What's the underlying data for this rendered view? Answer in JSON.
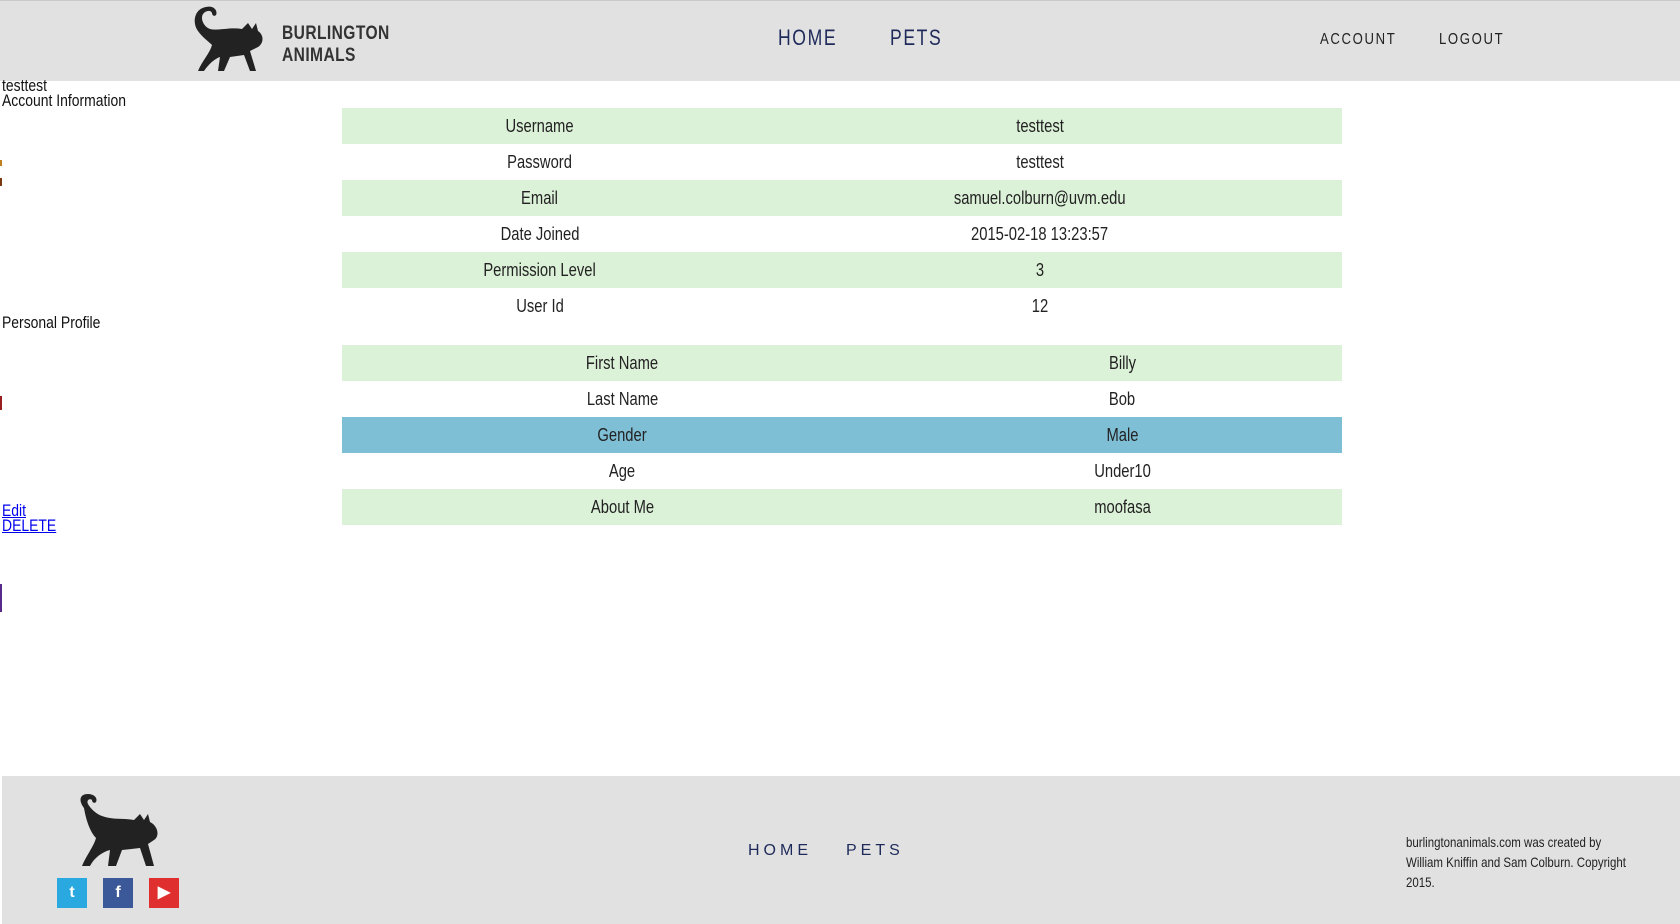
{
  "brand": {
    "line1": "BURLINGTON",
    "line2": "ANIMALS"
  },
  "main_nav": {
    "home": "HOME",
    "pets": "PETS"
  },
  "account_nav": {
    "account": "ACCOUNT",
    "logout": "LOGOUT"
  },
  "username_heading": "testtest",
  "account_heading": "Account Information",
  "account_info": [
    {
      "label": "Username",
      "value": "testtest"
    },
    {
      "label": "Password",
      "value": "testtest"
    },
    {
      "label": "Email",
      "value": "samuel.colburn@uvm.edu"
    },
    {
      "label": "Date Joined",
      "value": "2015-02-18 13:23:57"
    },
    {
      "label": "Permission Level",
      "value": "3"
    },
    {
      "label": "User Id",
      "value": "12"
    }
  ],
  "profile_heading": "Personal Profile",
  "profile": [
    {
      "label": "First Name",
      "value": "Billy"
    },
    {
      "label": "Last Name",
      "value": "Bob"
    },
    {
      "label": "Gender",
      "value": "Male"
    },
    {
      "label": "Age",
      "value": "Under10"
    },
    {
      "label": "About Me",
      "value": "moofasa"
    }
  ],
  "actions": {
    "edit": "Edit",
    "delete": "DELETE"
  },
  "footer": {
    "nav_home": "HOME",
    "nav_pets": "PETS",
    "credits": "burlingtonanimals.com was created by William Kniffin and Sam Colburn. Copyright 2015."
  },
  "social": {
    "twitter": "twitter-icon",
    "facebook": "facebook-icon",
    "youtube": "youtube-icon"
  },
  "colors": {
    "header_bg": "#e1e1e1",
    "row_green": "#dcf2d8",
    "row_highlight": "#7fbfd6",
    "nav_blue": "#1e2a5a",
    "twitter": "#2aa9e0",
    "facebook": "#3b5998",
    "youtube": "#e02f2f"
  }
}
